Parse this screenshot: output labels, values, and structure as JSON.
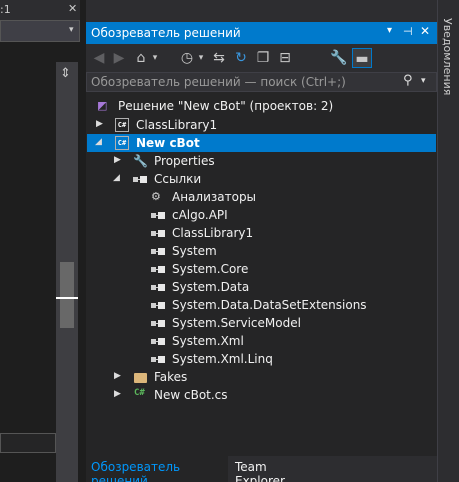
{
  "left": {
    "tab_fragment": ":1",
    "close_glyph": "✕",
    "dropdown_glyph": "▾",
    "pin_glyph": "⇕"
  },
  "panel": {
    "title": "Обозреватель решений",
    "title_buttons": {
      "dropdown": "▾",
      "pin": "⊣",
      "close": "✕"
    },
    "search_placeholder": "Обозреватель решений — поиск (Ctrl+;)",
    "toolbar_icons": [
      "back-icon",
      "forward-icon",
      "home-icon",
      "dropdown",
      "history-icon",
      "dropdown",
      "sync-icon",
      "refresh-icon",
      "copy-icon",
      "collapse-icon",
      "properties-icon",
      "preview-icon"
    ]
  },
  "tree": {
    "solution": "Решение \"New cBot\"  (проектов: 2)",
    "class_library_project": "ClassLibrary1",
    "cbot_project": "New cBot",
    "properties": "Properties",
    "references": "Ссылки",
    "refs": [
      "Анализаторы",
      "cAlgo.API",
      "ClassLibrary1",
      "System",
      "System.Core",
      "System.Data",
      "System.Data.DataSetExtensions",
      "System.ServiceModel",
      "System.Xml",
      "System.Xml.Linq"
    ],
    "fakes": "Fakes",
    "file": "New cBot.cs",
    "cs_badge": "C#"
  },
  "bottom_tabs": {
    "solution_explorer": "Обозреватель решений",
    "team_explorer": "Team Explorer"
  },
  "right_strip": {
    "notifications": "Уведомления"
  },
  "colors": {
    "accent": "#007acc",
    "panel_bg": "#252526",
    "chrome_bg": "#2d2d30"
  }
}
